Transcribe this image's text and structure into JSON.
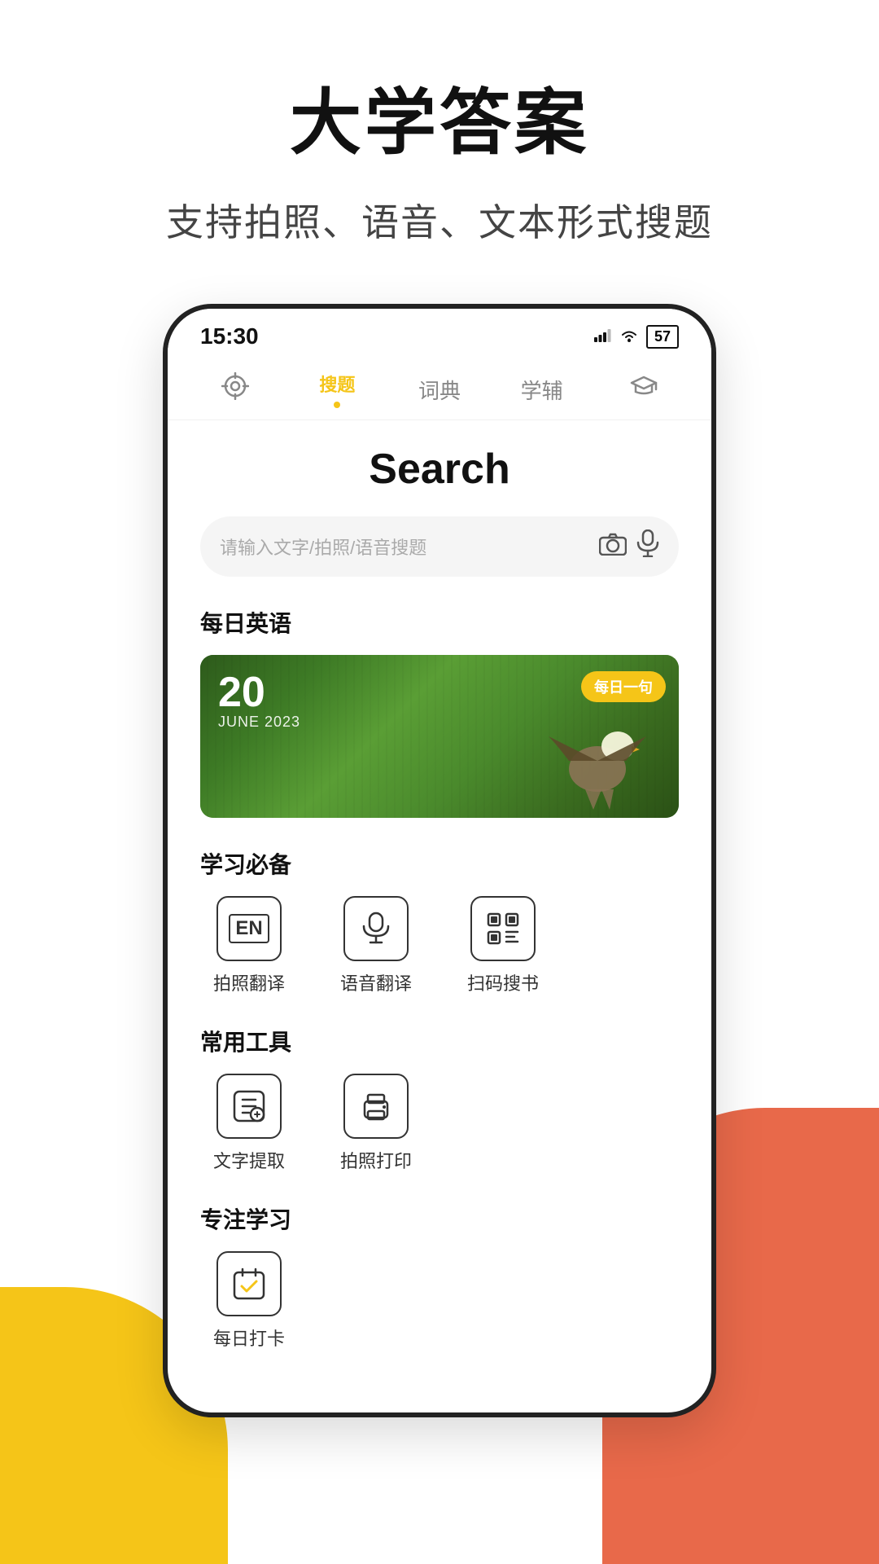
{
  "header": {
    "title": "大学答案",
    "subtitle": "支持拍照、语音、文本形式搜题"
  },
  "status_bar": {
    "time": "15:30",
    "signal": "📶",
    "wifi": "WiFi",
    "battery": "57"
  },
  "nav": {
    "items": [
      {
        "icon": "settings",
        "label": "",
        "active": false
      },
      {
        "icon": "search",
        "label": "搜题",
        "active": true
      },
      {
        "icon": "dict",
        "label": "词典",
        "active": false
      },
      {
        "icon": "tutor",
        "label": "学辅",
        "active": false
      },
      {
        "icon": "graduation",
        "label": "",
        "active": false
      }
    ]
  },
  "search_page": {
    "title": "Search",
    "search_placeholder": "请输入文字/拍照/语音搜题"
  },
  "daily_english": {
    "section_title": "每日英语",
    "date_number": "20",
    "date_month": "JUNE  2023",
    "badge": "每日一句"
  },
  "study_tools": {
    "section_title": "学习必备",
    "items": [
      {
        "icon": "photo-translate",
        "label": "拍照翻译"
      },
      {
        "icon": "voice-translate",
        "label": "语音翻译"
      },
      {
        "icon": "scan-book",
        "label": "扫码搜书"
      }
    ]
  },
  "common_tools": {
    "section_title": "常用工具",
    "items": [
      {
        "icon": "text-extract",
        "label": "文字提取"
      },
      {
        "icon": "photo-print",
        "label": "拍照打印"
      }
    ]
  },
  "focus_study": {
    "section_title": "专注学习",
    "items": [
      {
        "icon": "daily-checkin",
        "label": "每日打卡"
      }
    ]
  },
  "decorations": {
    "yellow_shape": "#F5C518",
    "red_shape": "#E8694A"
  }
}
